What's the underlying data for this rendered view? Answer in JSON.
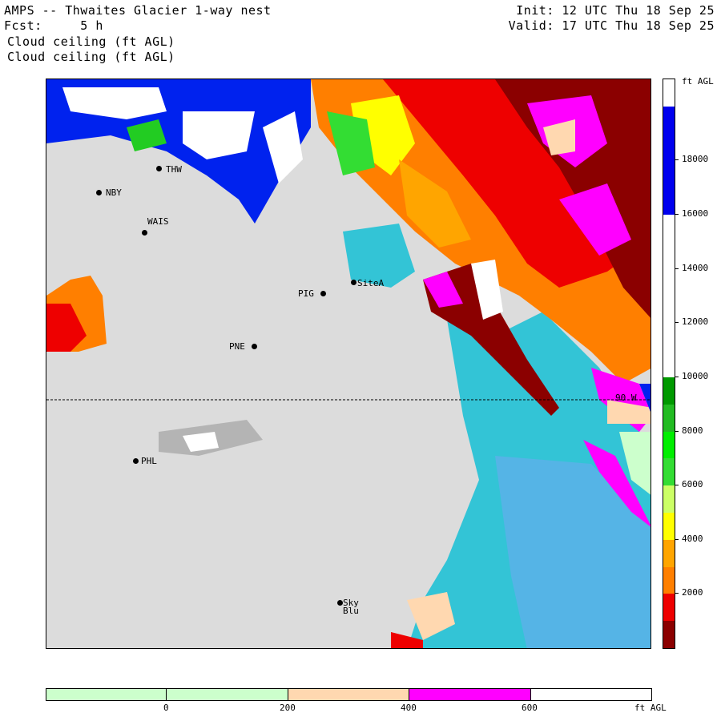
{
  "header": {
    "title": "AMPS -- Thwaites Glacier 1-way nest",
    "fcst": "Fcst:     5 h",
    "field1": "Cloud ceiling (ft AGL)",
    "field2": "Cloud ceiling (ft AGL)",
    "init": "Init: 12 UTC Thu 18 Sep 25",
    "valid": "Valid: 17 UTC Thu 18 Sep 25"
  },
  "stations": [
    {
      "id": "THW",
      "label": "THW"
    },
    {
      "id": "NBY",
      "label": "NBY"
    },
    {
      "id": "WAIS",
      "label": "WAIS"
    },
    {
      "id": "SiteA",
      "label": "SiteA"
    },
    {
      "id": "PIG",
      "label": "PIG"
    },
    {
      "id": "PNE",
      "label": "PNE"
    },
    {
      "id": "PHL",
      "label": "PHL"
    },
    {
      "id": "Sky",
      "label": "Sky"
    },
    {
      "id": "Blu",
      "label": "Blu"
    }
  ],
  "meridian_label": "90 W",
  "colorbar_vertical": {
    "unit": "ft AGL",
    "labels": [
      "2000",
      "4000",
      "6000",
      "8000",
      "10000",
      "12000",
      "14000",
      "16000",
      "18000"
    ],
    "bands": [
      {
        "from": 0,
        "to": 1000,
        "color": "#8b0000"
      },
      {
        "from": 1000,
        "to": 2000,
        "color": "#ee0000"
      },
      {
        "from": 2000,
        "to": 3000,
        "color": "#ff7f00"
      },
      {
        "from": 3000,
        "to": 4000,
        "color": "#ffa500"
      },
      {
        "from": 4000,
        "to": 5000,
        "color": "#ffff00"
      },
      {
        "from": 5000,
        "to": 6000,
        "color": "#ccff66"
      },
      {
        "from": 6000,
        "to": 7000,
        "color": "#33dd33"
      },
      {
        "from": 7000,
        "to": 8000,
        "color": "#00ee00"
      },
      {
        "from": 8000,
        "to": 9000,
        "color": "#22bb22"
      },
      {
        "from": 9000,
        "to": 10000,
        "color": "#009900"
      },
      {
        "from": 10000,
        "to": 16000,
        "color": "#ffffff"
      },
      {
        "from": 16000,
        "to": 20000,
        "color": "#0000ee"
      },
      {
        "from": 20000,
        "to": 21000,
        "color": "#ffffff"
      }
    ]
  },
  "colorbar_horizontal": {
    "unit": "ft AGL",
    "labels": [
      "0",
      "200",
      "400",
      "600"
    ],
    "bands": [
      {
        "color": "#ccffcc"
      },
      {
        "color": "#ccffcc"
      },
      {
        "color": "#ffd8b0"
      },
      {
        "color": "#ff00ff"
      },
      {
        "color": "#ffffff"
      }
    ]
  }
}
